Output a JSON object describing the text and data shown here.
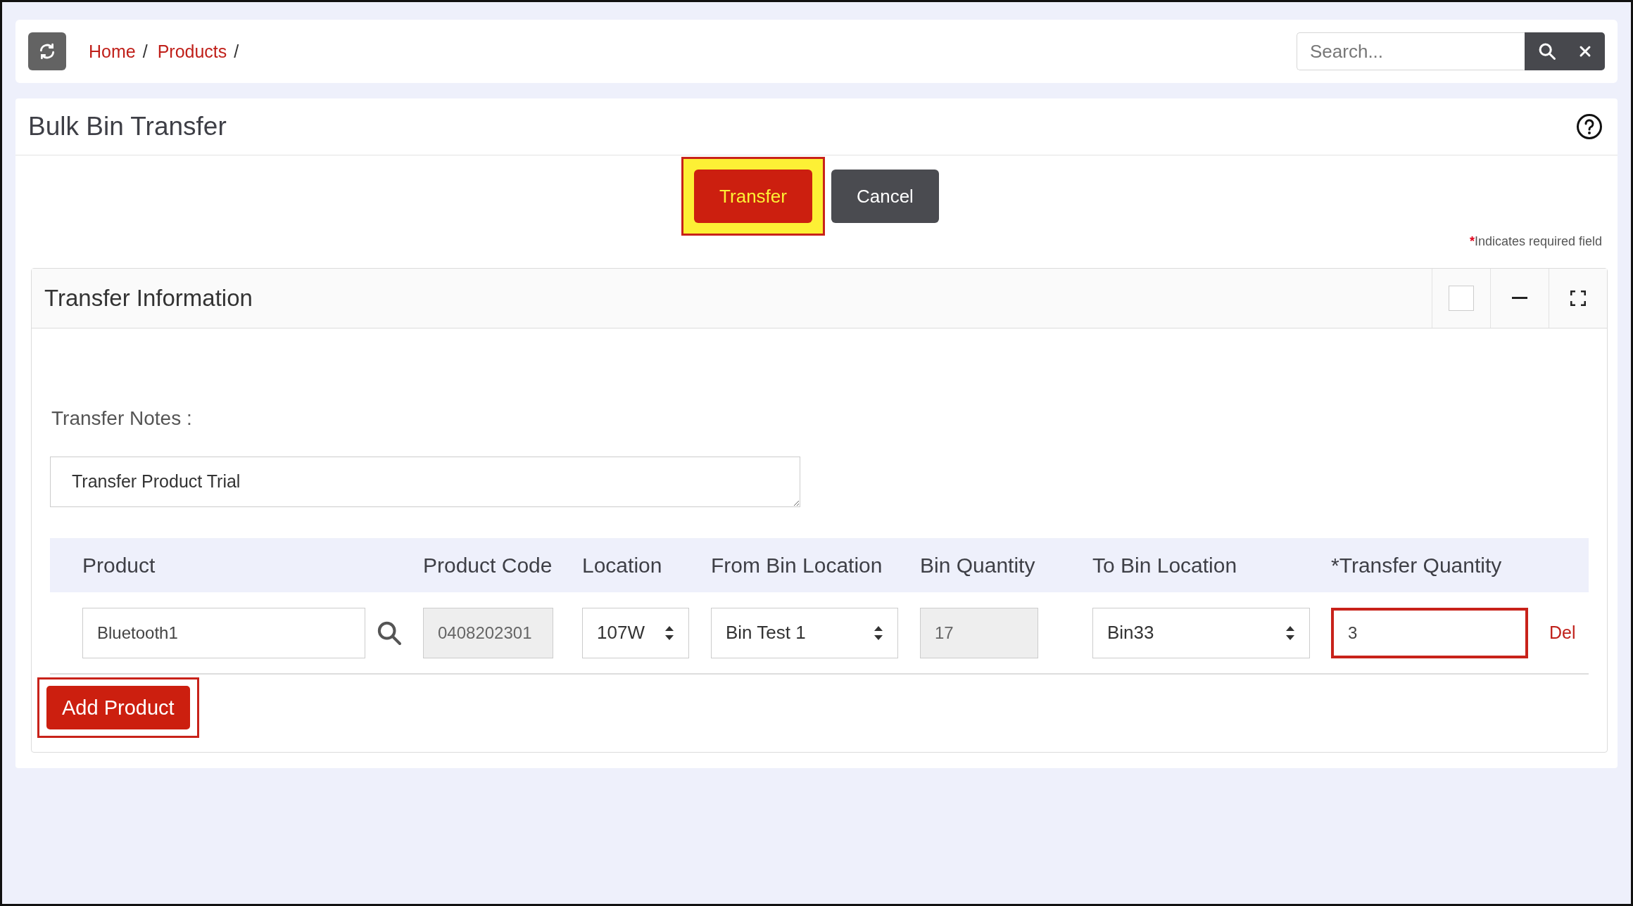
{
  "topbar": {
    "breadcrumbs": [
      {
        "label": "Home",
        "separator": "/"
      },
      {
        "label": "Products",
        "separator": "/"
      }
    ],
    "search": {
      "placeholder": "Search..."
    }
  },
  "page": {
    "title": "Bulk Bin Transfer"
  },
  "actions": [
    {
      "label": "Transfer",
      "kind": "primary",
      "highlighted": true
    },
    {
      "label": "Cancel",
      "kind": "secondary",
      "highlighted": false
    }
  ],
  "required_note": {
    "mark": "*",
    "text": "Indicates required field"
  },
  "panel": {
    "title": "Transfer Information",
    "select_checked": false,
    "notes_label": "Transfer Notes :",
    "notes_value": "Transfer Product Trial",
    "table": {
      "columns": [
        "Product",
        "Product Code",
        "Location",
        "From Bin Location",
        "Bin Quantity",
        "To Bin Location",
        "*Transfer Quantity"
      ],
      "rows": [
        {
          "product": "Bluetooth1",
          "product_code": "0408202301",
          "location": "107W",
          "from_bin": "Bin Test 1",
          "bin_quantity": "17",
          "to_bin": "Bin33",
          "transfer_quantity": "3",
          "transfer_quantity_highlighted": true,
          "delete": "Del"
        }
      ]
    },
    "add_button": {
      "label": "Add Product",
      "highlighted": true
    }
  }
}
